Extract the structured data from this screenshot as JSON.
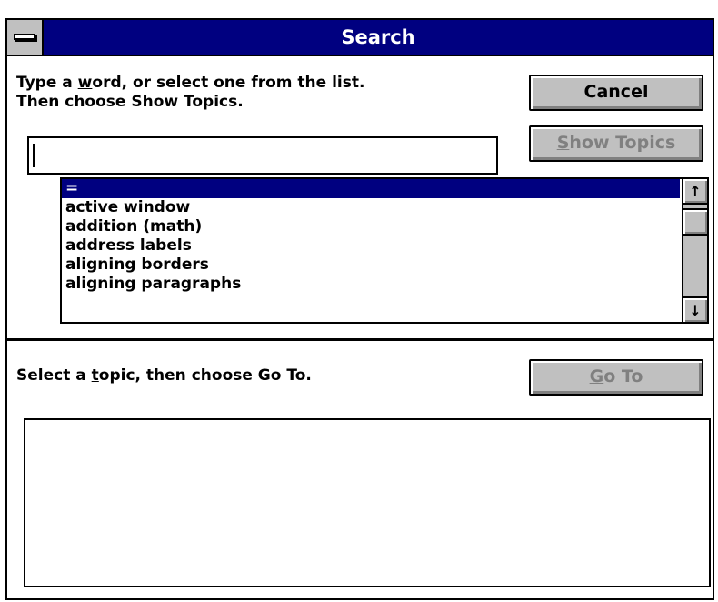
{
  "window": {
    "title": "Search"
  },
  "search": {
    "instruction_line1": "Type a word, or select one from the list.",
    "instruction_line1_pre": "Type a ",
    "instruction_line1_hotkey": "w",
    "instruction_line1_post": "ord, or select one from the list.",
    "instruction_line2": "Then choose Show Topics.",
    "input_value": ""
  },
  "buttons": {
    "cancel_label": "Cancel",
    "show_topics_hotkey": "S",
    "show_topics_rest": "how Topics",
    "show_topics_enabled": false,
    "goto_hotkey": "G",
    "goto_rest": "o To",
    "goto_enabled": false
  },
  "keyword_list": {
    "items": [
      "=",
      "active window",
      "addition (math)",
      "address labels",
      "aligning borders",
      "aligning paragraphs"
    ],
    "selected_index": 0,
    "scroll_up_glyph": "↑",
    "scroll_down_glyph": "↓"
  },
  "topics": {
    "instruction_pre": "Select a ",
    "instruction_hotkey": "t",
    "instruction_post": "opic, then choose Go To.",
    "items": []
  },
  "colors": {
    "titlebar": "#000080",
    "selection": "#000080",
    "button_face": "#c0c0c0",
    "disabled_text": "#808080"
  },
  "icons": {
    "system_menu": "system-menu-icon",
    "scroll_up": "scroll-up-arrow-icon",
    "scroll_down": "scroll-down-arrow-icon"
  }
}
